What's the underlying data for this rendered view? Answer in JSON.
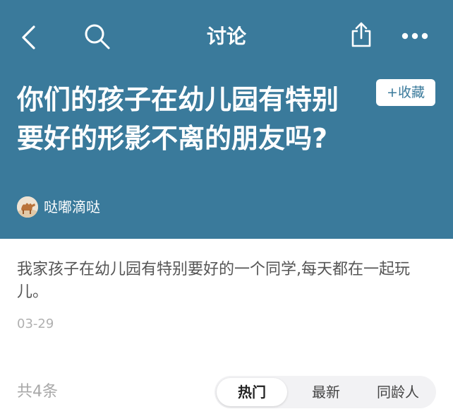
{
  "nav": {
    "title": "讨论",
    "icons": [
      "back-icon",
      "search-icon",
      "share-icon",
      "more-icon"
    ]
  },
  "topic": {
    "title": "你们的孩子在幼儿园有特别要好的形影不离的朋友吗?",
    "favorite_label": "+收藏",
    "author": "哒嘟滴哒",
    "body": "我家孩子在幼儿园有特别要好的一个同学,每天都在一起玩儿。",
    "date": "03-29"
  },
  "comments": {
    "count_label": "共4条",
    "sort_tabs": [
      {
        "label": "热门",
        "active": true
      },
      {
        "label": "最新",
        "active": false
      },
      {
        "label": "同龄人",
        "active": false
      }
    ]
  },
  "colors": {
    "header_bg": "#3a7a9b",
    "accent": "#3a7a9b",
    "date_gray": "#b0b0b0"
  }
}
